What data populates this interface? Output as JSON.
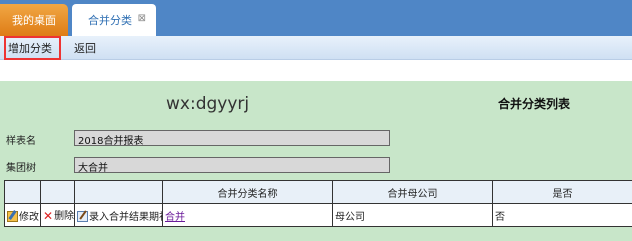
{
  "tabs": {
    "desktop": "我的桌面",
    "active": "合并分类",
    "close_glyph": "⊠"
  },
  "toolbar": {
    "add_label": "增加分类",
    "back_label": "返回"
  },
  "watermark": "wx:dgyyrj",
  "page_title": "合并分类列表",
  "fields": {
    "template_label": "样表名",
    "template_value": "2018合并报表",
    "group_label": "集团树",
    "group_value": "大合并"
  },
  "grid": {
    "headers": [
      "",
      "",
      "",
      "合并分类名称",
      "合并母公司",
      "是否"
    ],
    "row": {
      "edit": "修改",
      "delete": "删除",
      "record": "录入合并结果期初",
      "name": "合并",
      "parent": "母公司",
      "flag": "否"
    }
  },
  "colors": {
    "tab_bar": "#4f86c6",
    "desktop_tab": "#e8902c",
    "content_bg": "#c8e6c9",
    "highlight": "#ee3333"
  },
  "icons": [
    "edit-icon",
    "delete-icon",
    "record-icon",
    "tab-close-icon"
  ]
}
